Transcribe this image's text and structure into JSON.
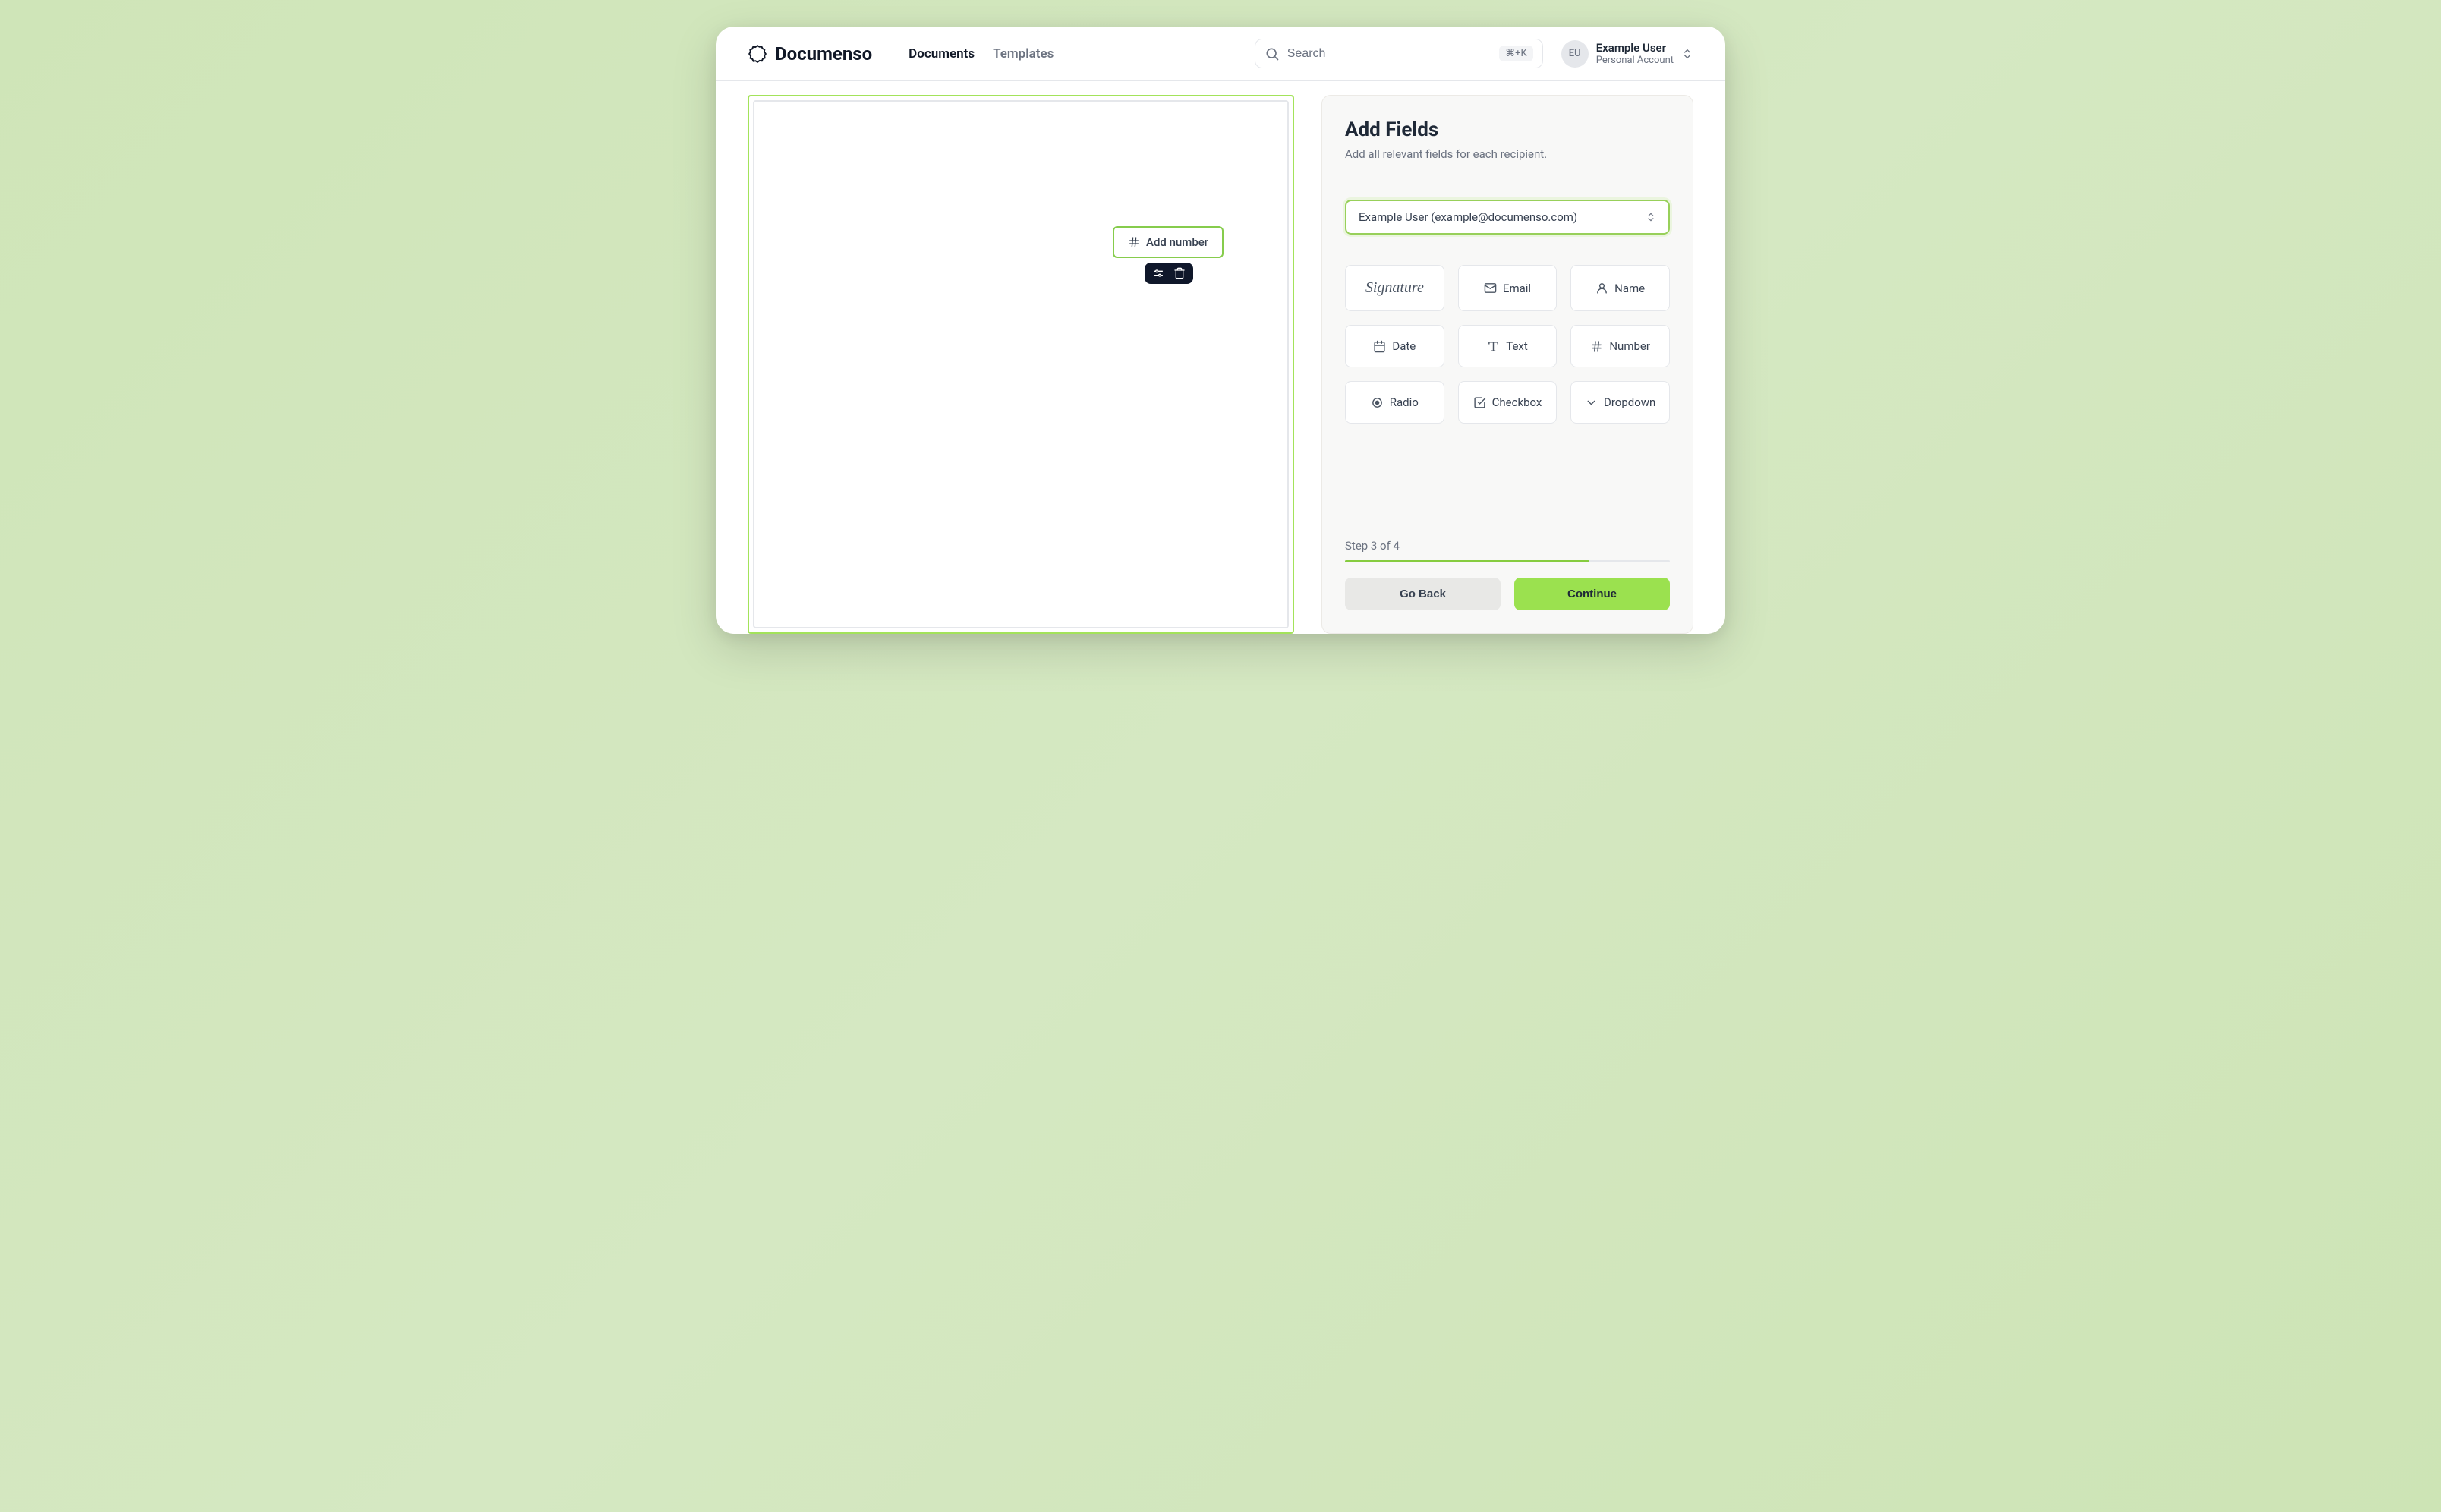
{
  "brand": "Documenso",
  "nav": {
    "documents": "Documents",
    "templates": "Templates"
  },
  "search": {
    "placeholder": "Search",
    "shortcut": "⌘+K"
  },
  "account": {
    "initials": "EU",
    "name": "Example User",
    "type": "Personal Account"
  },
  "placed_field": {
    "label": "Add number"
  },
  "panel": {
    "title": "Add Fields",
    "subtitle": "Add all relevant fields for each recipient.",
    "recipient": "Example User (example@documenso.com)",
    "fields": {
      "signature": "Signature",
      "email": "Email",
      "name": "Name",
      "date": "Date",
      "text": "Text",
      "number": "Number",
      "radio": "Radio",
      "checkbox": "Checkbox",
      "dropdown": "Dropdown"
    },
    "step_label": "Step 3 of 4",
    "step_current": 3,
    "step_total": 4,
    "go_back": "Go Back",
    "continue": "Continue"
  }
}
